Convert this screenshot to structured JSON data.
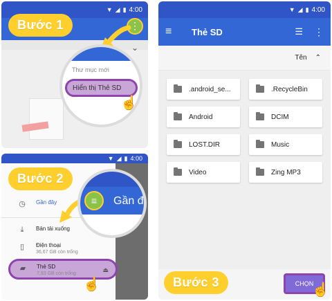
{
  "colors": {
    "badge": "#ffcf2e",
    "highlight": "#8e44ad",
    "toolbar": "#3367d6"
  },
  "status": {
    "time": "4:00"
  },
  "step1": {
    "badge": "Bước 1",
    "menu_new_folder": "Thư mục mới",
    "menu_show_sd": "Hiển thị Thẻ SD"
  },
  "step2": {
    "badge": "Bước 2",
    "magnified_title": "Gần đây",
    "drawer": {
      "recent": "Gần đây",
      "downloads": "Bản tải xuống",
      "phone": "Điện thoại",
      "phone_free": "36,67 GB còn trống",
      "sd": "Thẻ SD",
      "sd_free": "7,93 GB còn trống"
    }
  },
  "step3": {
    "badge": "Bước 3",
    "title": "Thẻ SD",
    "sort_label": "Tên",
    "choose_button": "CHỌN",
    "folders": [
      ".android_se...",
      ".RecycleBin",
      "Android",
      "DCIM",
      "LOST.DIR",
      "Music",
      "Video",
      "Zing MP3"
    ]
  }
}
